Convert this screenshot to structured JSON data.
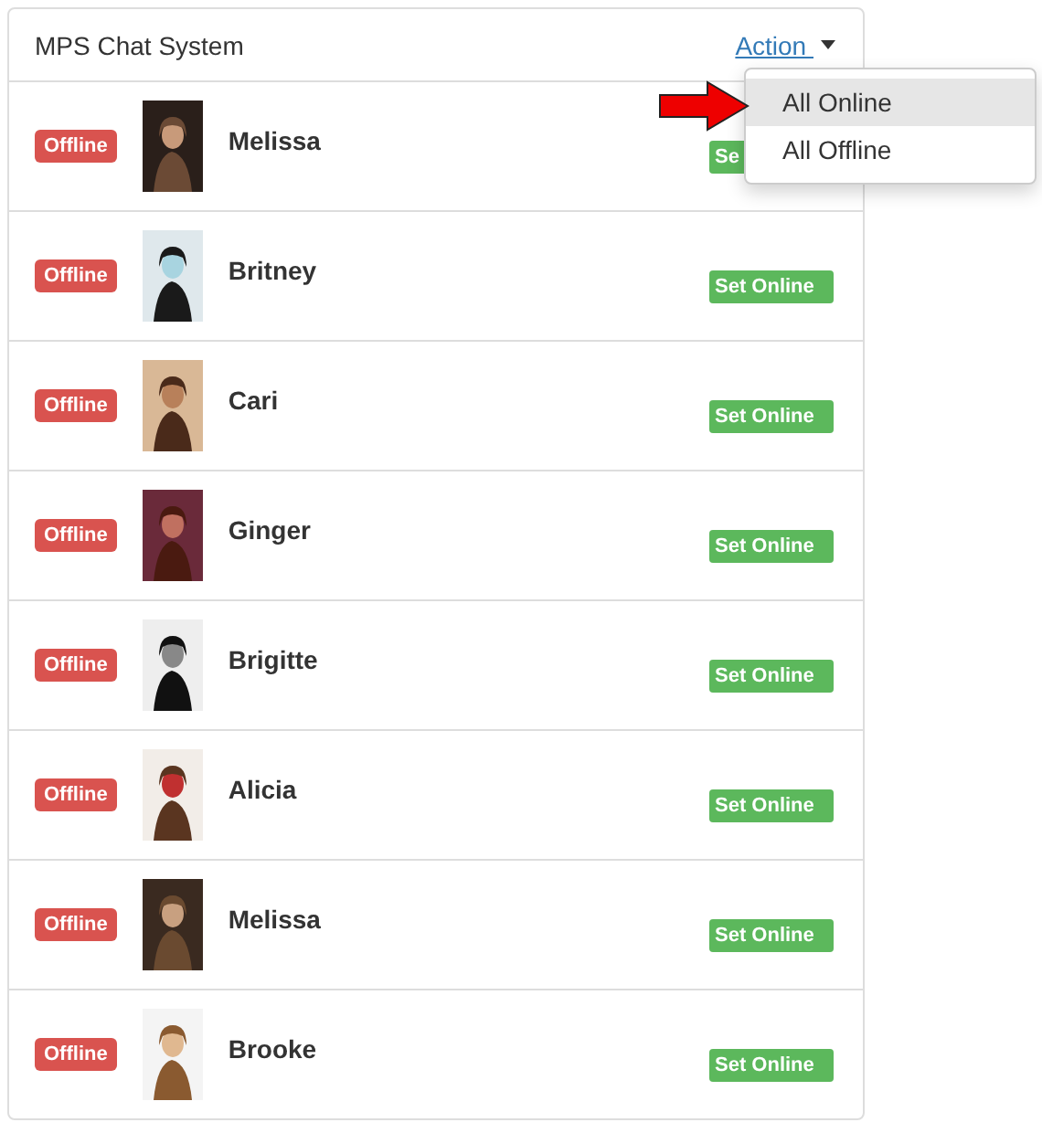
{
  "panel": {
    "title": "MPS Chat System",
    "action": "Action "
  },
  "menu": [
    {
      "label": "All Online",
      "selected": true
    },
    {
      "label": "All Offline",
      "selected": false
    }
  ],
  "users": [
    {
      "status": "Offline",
      "name": "Melissa",
      "button": "Se"
    },
    {
      "status": "Offline",
      "name": "Britney",
      "button": "Set Online"
    },
    {
      "status": "Offline",
      "name": "Cari",
      "button": "Set Online"
    },
    {
      "status": "Offline",
      "name": "Ginger",
      "button": "Set Online"
    },
    {
      "status": "Offline",
      "name": "Brigitte",
      "button": "Set Online"
    },
    {
      "status": "Offline",
      "name": "Alicia",
      "button": "Set Online"
    },
    {
      "status": "Offline",
      "name": "Melissa",
      "button": "Set Online"
    },
    {
      "status": "Offline",
      "name": "Brooke",
      "button": "Set Online"
    }
  ]
}
